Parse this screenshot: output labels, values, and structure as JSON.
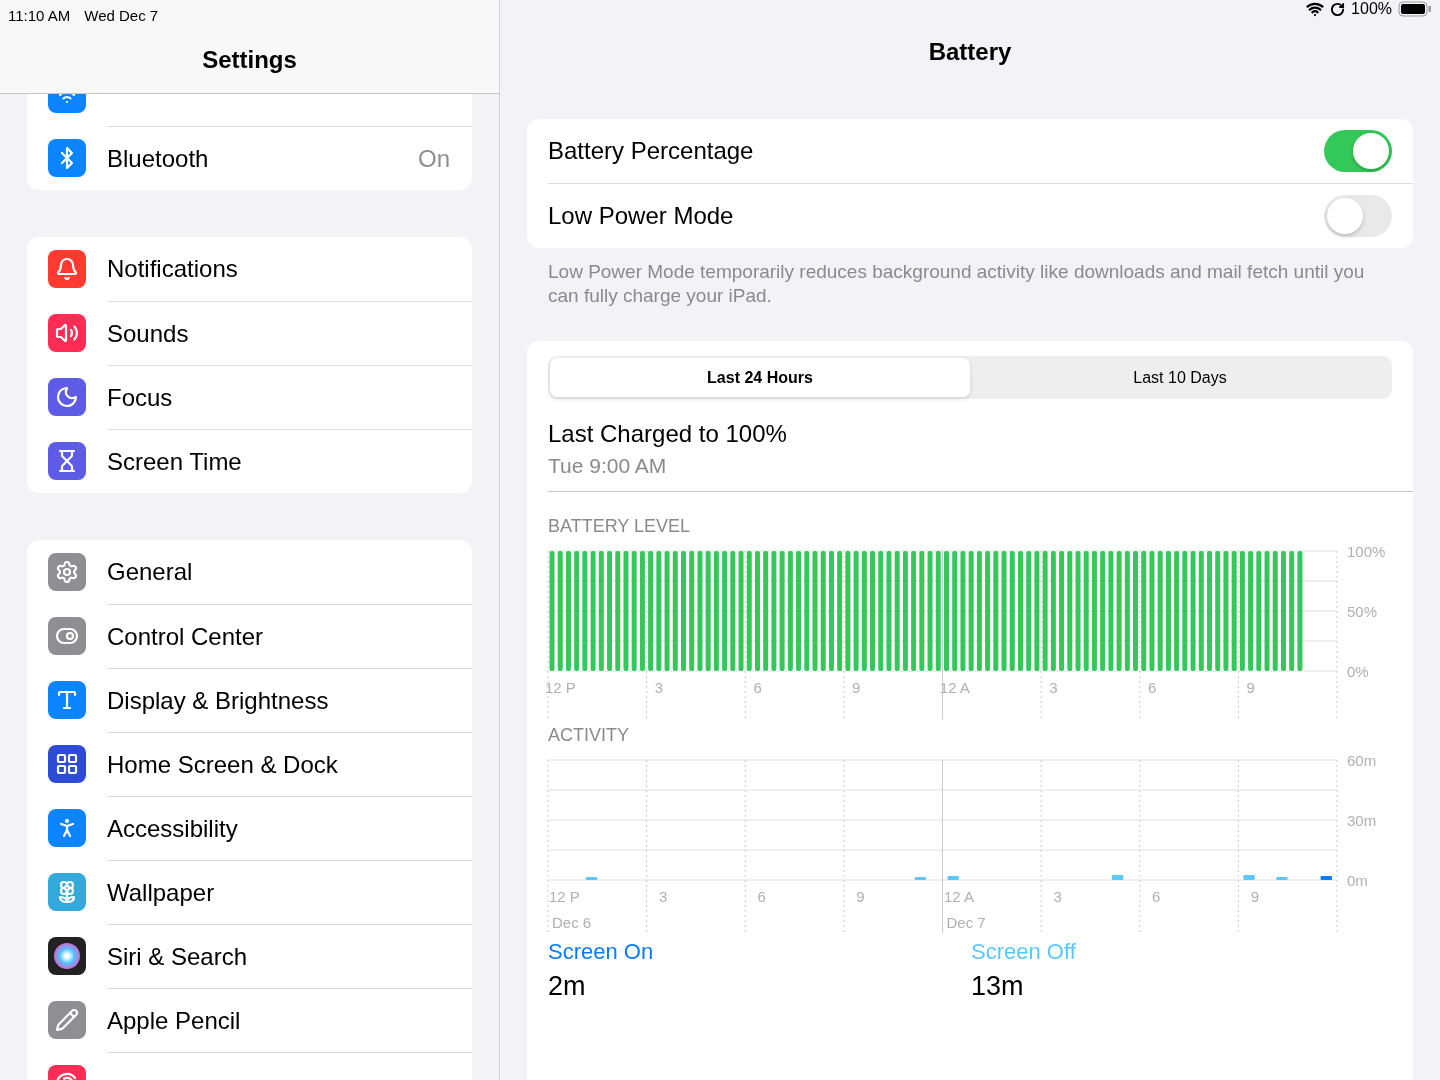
{
  "status_bar": {
    "time": "11:10 AM",
    "date": "Wed Dec 7",
    "battery": "100%"
  },
  "sidebar": {
    "title": "Settings",
    "groups": [
      {
        "clipped_top": true,
        "items": [
          {
            "label": "Bluetooth",
            "value": "On"
          }
        ]
      },
      {
        "items": [
          {
            "label": "Notifications"
          },
          {
            "label": "Sounds"
          },
          {
            "label": "Focus"
          },
          {
            "label": "Screen Time"
          }
        ]
      },
      {
        "items": [
          {
            "label": "General"
          },
          {
            "label": "Control Center"
          },
          {
            "label": "Display & Brightness"
          },
          {
            "label": "Home Screen & Dock"
          },
          {
            "label": "Accessibility"
          },
          {
            "label": "Wallpaper"
          },
          {
            "label": "Siri & Search"
          },
          {
            "label": "Apple Pencil"
          }
        ],
        "clipped_bottom": true
      }
    ]
  },
  "detail": {
    "title": "Battery",
    "toggles": [
      {
        "label": "Battery Percentage",
        "on": true
      },
      {
        "label": "Low Power Mode",
        "on": false
      }
    ],
    "toggle_note": "Low Power Mode temporarily reduces background activity like downloads and mail fetch until you can fully charge your iPad.",
    "tabs": [
      {
        "label": "Last 24 Hours",
        "selected": true
      },
      {
        "label": "Last 10 Days",
        "selected": false
      }
    ],
    "last_charged": {
      "title": "Last Charged to 100%",
      "time": "Tue 9:00 AM"
    },
    "battery_chart": {
      "chart_data": {
        "type": "bar",
        "title": "BATTERY LEVEL",
        "categories": [
          null,
          "12 P",
          null,
          null,
          null,
          null,
          null,
          null,
          null,
          null,
          null,
          null,
          null,
          "3",
          null,
          null,
          null,
          null,
          null,
          null,
          null,
          null,
          null,
          null,
          null,
          "6",
          null,
          null,
          null,
          null,
          null,
          null,
          null,
          null,
          null,
          null,
          null,
          "9",
          null,
          null,
          null,
          null,
          null,
          null,
          null,
          null,
          null,
          null,
          null,
          "12 A",
          null,
          null,
          null,
          null,
          null,
          null,
          null,
          null,
          null,
          null,
          null,
          "3",
          null,
          null,
          null,
          null,
          null,
          null,
          null,
          null,
          null,
          null,
          null,
          "6",
          null,
          null,
          null,
          null,
          null,
          null,
          null,
          null,
          null,
          null,
          null,
          "9",
          null,
          null,
          null,
          null,
          null,
          null
        ],
        "yticks": [
          {
            "value": 100,
            "label": "100%"
          },
          {
            "value": 50,
            "label": "50%"
          },
          {
            "value": 0,
            "label": "0%"
          }
        ],
        "ylim": [
          0,
          100
        ],
        "series": [
          {
            "color": "#34c759",
            "values": [
              100,
              100,
              100,
              100,
              100,
              100,
              100,
              100,
              100,
              100,
              100,
              100,
              100,
              100,
              100,
              100,
              100,
              100,
              100,
              100,
              100,
              100,
              100,
              100,
              100,
              100,
              100,
              100,
              100,
              100,
              100,
              100,
              100,
              100,
              100,
              100,
              100,
              100,
              100,
              100,
              100,
              100,
              100,
              100,
              100,
              100,
              100,
              100,
              100,
              100,
              100,
              100,
              100,
              100,
              100,
              100,
              100,
              100,
              100,
              100,
              100,
              100,
              100,
              100,
              100,
              100,
              100,
              100,
              100,
              100,
              100,
              100,
              100,
              100,
              100,
              100,
              100,
              100,
              100,
              100,
              100,
              100,
              100,
              100,
              100,
              100,
              100,
              100,
              100,
              100,
              100,
              100
            ]
          }
        ]
      }
    },
    "activity_chart": {
      "date_labels": [
        "Dec 6",
        "Dec 7"
      ],
      "chart_data": {
        "type": "bar",
        "title": "ACTIVITY",
        "stacked": false,
        "categories": [
          "12 P",
          null,
          null,
          "3",
          null,
          null,
          "6",
          null,
          null,
          "9",
          null,
          null,
          "12 A",
          null,
          null,
          "3",
          null,
          null,
          "6",
          null,
          null,
          "9",
          null,
          null
        ],
        "yticks": [
          {
            "value": 60,
            "label": "60m"
          },
          {
            "value": 30,
            "label": "30m"
          },
          {
            "value": 0,
            "label": "0m"
          }
        ],
        "ylim": [
          0,
          60
        ],
        "series": [
          {
            "name": "Screen On",
            "color": "#0a7aff",
            "values": [
              0,
              0,
              0,
              0,
              0,
              0,
              0,
              0,
              0,
              0,
              0,
              0,
              0,
              0,
              0,
              0,
              0,
              0,
              0,
              0,
              0,
              0,
              0,
              2
            ]
          },
          {
            "name": "Screen Off",
            "color": "#5ac8fa",
            "values": [
              0,
              1.5,
              0,
              0,
              0,
              0,
              0,
              0,
              0,
              0,
              0,
              1.5,
              2,
              0,
              0,
              0,
              0,
              2.5,
              0,
              0,
              0,
              2.5,
              1.5,
              0
            ]
          }
        ]
      }
    },
    "summary": [
      "2m",
      "13m"
    ]
  }
}
